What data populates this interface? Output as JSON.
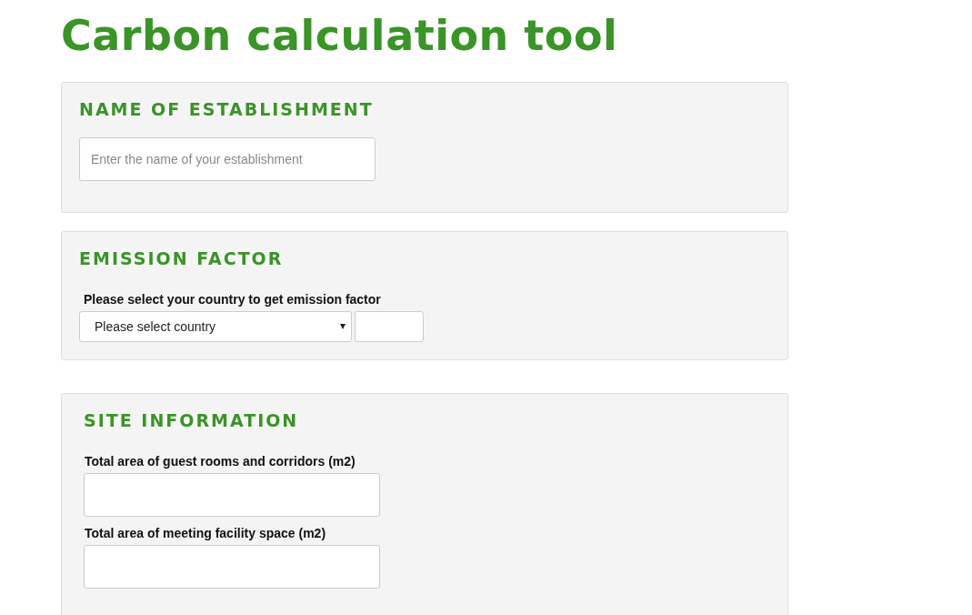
{
  "page_title": "Carbon calculation tool",
  "sections": [
    {
      "kind": "text-input",
      "heading": "NAME OF ESTABLISHMENT",
      "placeholder": "Enter the name of your establishment"
    },
    {
      "kind": "country-select",
      "heading": "EMISSION FACTOR",
      "label": "Please select your country to get emission factor",
      "select_value": "Please select country"
    },
    {
      "kind": "area-fields",
      "heading": "SITE INFORMATION",
      "fields": [
        {
          "label": "Total area of guest rooms and corridors (m2)"
        },
        {
          "label": "Total area of meeting facility space (m2)"
        }
      ]
    }
  ]
}
